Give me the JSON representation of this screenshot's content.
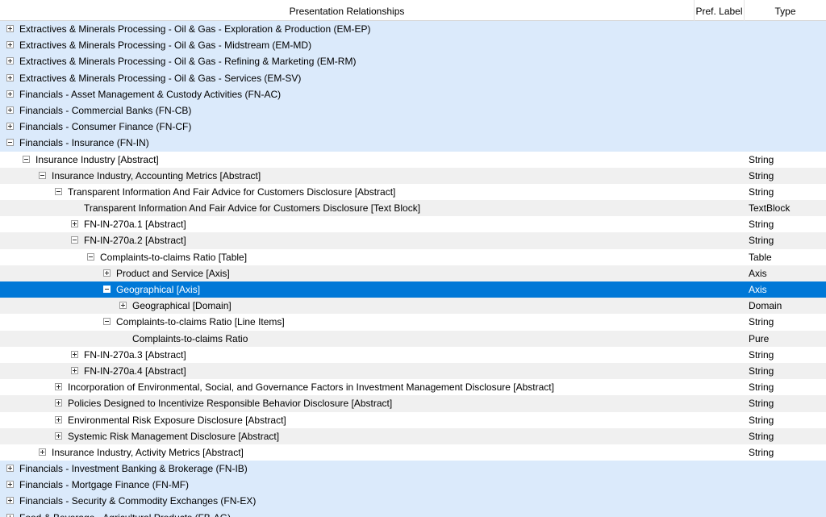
{
  "header": {
    "main": "Presentation Relationships",
    "pref": "Pref. Label",
    "type": "Type"
  },
  "rows": [
    {
      "level": 0,
      "toggle": "plus",
      "label": "Extractives & Minerals Processing - Oil & Gas - Exploration & Production (EM-EP)",
      "type": "",
      "style": "top"
    },
    {
      "level": 0,
      "toggle": "plus",
      "label": "Extractives & Minerals Processing - Oil & Gas - Midstream (EM-MD)",
      "type": "",
      "style": "top"
    },
    {
      "level": 0,
      "toggle": "plus",
      "label": "Extractives & Minerals Processing - Oil & Gas - Refining & Marketing (EM-RM)",
      "type": "",
      "style": "top"
    },
    {
      "level": 0,
      "toggle": "plus",
      "label": "Extractives & Minerals Processing - Oil & Gas - Services (EM-SV)",
      "type": "",
      "style": "top"
    },
    {
      "level": 0,
      "toggle": "plus",
      "label": "Financials - Asset Management & Custody Activities (FN-AC)",
      "type": "",
      "style": "top"
    },
    {
      "level": 0,
      "toggle": "plus",
      "label": "Financials - Commercial Banks (FN-CB)",
      "type": "",
      "style": "top"
    },
    {
      "level": 0,
      "toggle": "plus",
      "label": "Financials - Consumer Finance (FN-CF)",
      "type": "",
      "style": "top"
    },
    {
      "level": 0,
      "toggle": "minus",
      "label": "Financials - Insurance (FN-IN)",
      "type": "",
      "style": "top"
    },
    {
      "level": 1,
      "toggle": "minus",
      "label": "Insurance Industry [Abstract]",
      "type": "String",
      "style": "plain"
    },
    {
      "level": 2,
      "toggle": "minus",
      "label": "Insurance Industry, Accounting Metrics [Abstract]",
      "type": "String",
      "style": "alt"
    },
    {
      "level": 3,
      "toggle": "minus",
      "label": "Transparent Information And Fair Advice for Customers Disclosure [Abstract]",
      "type": "String",
      "style": "plain"
    },
    {
      "level": 4,
      "toggle": "none",
      "label": "Transparent Information And Fair Advice for Customers Disclosure [Text Block]",
      "type": "TextBlock",
      "style": "alt"
    },
    {
      "level": 4,
      "toggle": "plus",
      "label": "FN-IN-270a.1 [Abstract]",
      "type": "String",
      "style": "plain"
    },
    {
      "level": 4,
      "toggle": "minus",
      "label": "FN-IN-270a.2 [Abstract]",
      "type": "String",
      "style": "alt"
    },
    {
      "level": 5,
      "toggle": "minus",
      "label": "Complaints-to-claims Ratio [Table]",
      "type": "Table",
      "style": "plain"
    },
    {
      "level": 6,
      "toggle": "plus",
      "label": "Product and Service [Axis]",
      "type": "Axis",
      "style": "alt"
    },
    {
      "level": 6,
      "toggle": "minus",
      "label": "Geographical [Axis]",
      "type": "Axis",
      "style": "selected"
    },
    {
      "level": 7,
      "toggle": "plus",
      "label": "Geographical [Domain]",
      "type": "Domain",
      "style": "alt"
    },
    {
      "level": 6,
      "toggle": "minus",
      "label": "Complaints-to-claims Ratio [Line Items]",
      "type": "String",
      "style": "plain"
    },
    {
      "level": 7,
      "toggle": "none",
      "label": "Complaints-to-claims Ratio",
      "type": "Pure",
      "style": "alt"
    },
    {
      "level": 4,
      "toggle": "plus",
      "label": "FN-IN-270a.3 [Abstract]",
      "type": "String",
      "style": "plain"
    },
    {
      "level": 4,
      "toggle": "plus",
      "label": "FN-IN-270a.4 [Abstract]",
      "type": "String",
      "style": "alt"
    },
    {
      "level": 3,
      "toggle": "plus",
      "label": "Incorporation of Environmental, Social, and Governance Factors in Investment Management Disclosure [Abstract]",
      "type": "String",
      "style": "plain"
    },
    {
      "level": 3,
      "toggle": "plus",
      "label": "Policies Designed to Incentivize Responsible Behavior Disclosure [Abstract]",
      "type": "String",
      "style": "alt"
    },
    {
      "level": 3,
      "toggle": "plus",
      "label": "Environmental Risk Exposure Disclosure [Abstract]",
      "type": "String",
      "style": "plain"
    },
    {
      "level": 3,
      "toggle": "plus",
      "label": "Systemic Risk Management Disclosure [Abstract]",
      "type": "String",
      "style": "alt"
    },
    {
      "level": 2,
      "toggle": "plus",
      "label": "Insurance Industry, Activity Metrics [Abstract]",
      "type": "String",
      "style": "plain"
    },
    {
      "level": 0,
      "toggle": "plus",
      "label": "Financials - Investment Banking & Brokerage (FN-IB)",
      "type": "",
      "style": "top"
    },
    {
      "level": 0,
      "toggle": "plus",
      "label": "Financials - Mortgage Finance (FN-MF)",
      "type": "",
      "style": "top"
    },
    {
      "level": 0,
      "toggle": "plus",
      "label": "Financials - Security & Commodity Exchanges (FN-EX)",
      "type": "",
      "style": "top"
    },
    {
      "level": 0,
      "toggle": "plus",
      "label": "Food & Beverage - Agricultural Products (FB-AG)",
      "type": "",
      "style": "top"
    }
  ]
}
